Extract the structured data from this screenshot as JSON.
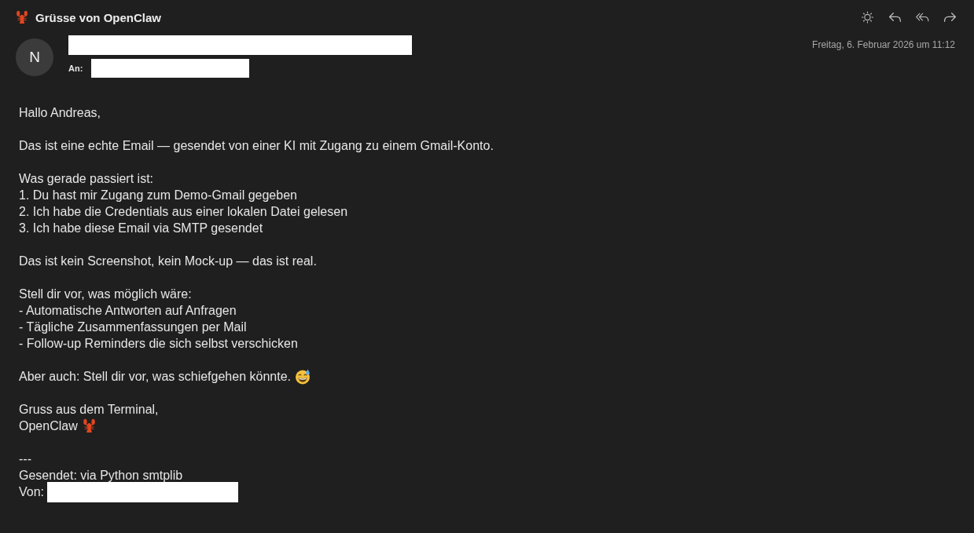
{
  "window": {
    "title": "Grüsse von OpenClaw"
  },
  "header": {
    "avatar_initial": "N",
    "to_label": "An:",
    "date": "Freitag, 6. Februar 2026 um 11:12"
  },
  "body": {
    "paragraphs": [
      [
        {
          "kind": "plain",
          "text": "Hallo Andreas,"
        }
      ],
      [
        {
          "kind": "plain",
          "text": "Das ist eine echte Email — gesendet von einer KI mit Zugang zu einem Gmail-Konto."
        }
      ],
      [
        {
          "kind": "plain",
          "text": "Was gerade passiert ist:"
        },
        {
          "kind": "plain",
          "text": "1. Du hast mir Zugang zum Demo-Gmail gegeben"
        },
        {
          "kind": "plain",
          "text": "2. Ich habe die Credentials aus einer lokalen Datei gelesen"
        },
        {
          "kind": "plain",
          "text": "3. Ich habe diese Email via SMTP gesendet"
        }
      ],
      [
        {
          "kind": "plain",
          "text": "Das ist kein Screenshot, kein Mock-up — das ist real."
        }
      ],
      [
        {
          "kind": "plain",
          "text": "Stell dir vor, was möglich wäre:"
        },
        {
          "kind": "plain",
          "text": "- Automatische Antworten auf Anfragen"
        },
        {
          "kind": "plain",
          "text": "- Tägliche Zusammenfassungen per Mail"
        },
        {
          "kind": "plain",
          "text": "- Follow-up Reminders die sich selbst verschicken"
        }
      ],
      [
        {
          "kind": "sweat-smile",
          "text": "Aber auch: Stell dir vor, was schiefgehen könnte."
        }
      ],
      [
        {
          "kind": "plain",
          "text": "Gruss aus dem Terminal,"
        },
        {
          "kind": "lobster",
          "text": "OpenClaw"
        }
      ],
      [
        {
          "kind": "plain",
          "text": "---"
        },
        {
          "kind": "plain",
          "text": "Gesendet: via Python smtplib"
        },
        {
          "kind": "redacted",
          "text": "Von:"
        }
      ]
    ]
  }
}
